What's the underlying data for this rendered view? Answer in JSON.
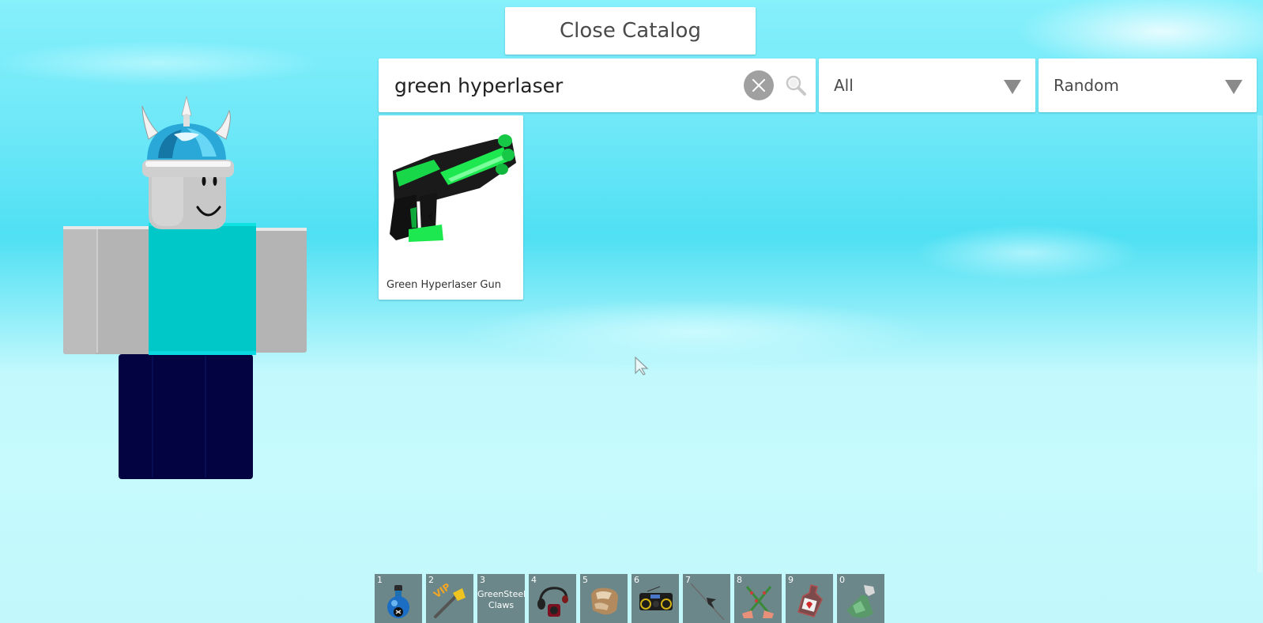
{
  "catalog": {
    "close_button_label": "Close Catalog",
    "search": {
      "value": "green hyperlaser",
      "placeholder": "",
      "clear_icon": "clear-circle-x-icon",
      "search_icon": "magnifier-icon"
    },
    "category_dropdown": {
      "selected": "All",
      "icon": "triangle-down-icon"
    },
    "sort_dropdown": {
      "selected": "Random",
      "icon": "triangle-down-icon"
    },
    "results": [
      {
        "name": "Green Hyperlaser Gun",
        "icon": "green-hyperlaser-gun-icon"
      }
    ]
  },
  "avatar": {
    "hat": "viking-helmet",
    "face": "smile",
    "torso_color": "#00c8c8",
    "arms_color": "#b4b4b4",
    "legs_color": "#020340",
    "head_color": "#c8c8c8"
  },
  "hotbar": {
    "slots": [
      {
        "key": "1",
        "icon": "blue-potion-icon",
        "text": ""
      },
      {
        "key": "2",
        "icon": "vip-axe-icon",
        "text": ""
      },
      {
        "key": "3",
        "icon": "",
        "text": "GreenSteel\nClaws"
      },
      {
        "key": "4",
        "icon": "headphones-icon",
        "text": ""
      },
      {
        "key": "5",
        "icon": "fur-hat-icon",
        "text": ""
      },
      {
        "key": "6",
        "icon": "boombox-icon",
        "text": ""
      },
      {
        "key": "7",
        "icon": "spear-icon",
        "text": ""
      },
      {
        "key": "8",
        "icon": "crossed-flower-swords-icon",
        "text": ""
      },
      {
        "key": "9",
        "icon": "red-bottle-icon",
        "text": ""
      },
      {
        "key": "0",
        "icon": "green-flask-icon",
        "text": ""
      }
    ]
  },
  "colors": {
    "slot_background": "#6b8789",
    "panel_background": "#ffffff",
    "accent_green": "#22d64a"
  }
}
